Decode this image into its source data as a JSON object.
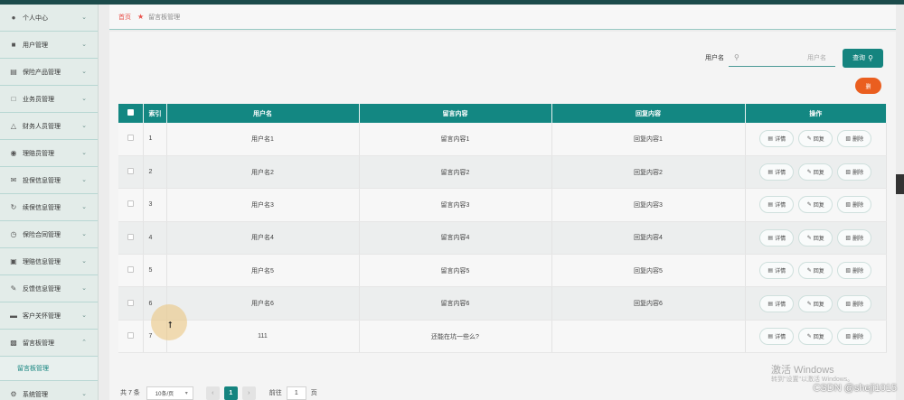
{
  "sidebar": {
    "items": [
      {
        "label": "个人中心",
        "icon": "user-icon"
      },
      {
        "label": "用户管理",
        "icon": "users-icon"
      },
      {
        "label": "保险产品管理",
        "icon": "product-icon"
      },
      {
        "label": "业务员管理",
        "icon": "briefcase-icon"
      },
      {
        "label": "财务人员管理",
        "icon": "finance-icon"
      },
      {
        "label": "理赔员管理",
        "icon": "location-icon"
      },
      {
        "label": "投保信息管理",
        "icon": "mail-icon"
      },
      {
        "label": "续保信息管理",
        "icon": "renew-icon"
      },
      {
        "label": "保险合同管理",
        "icon": "clock-icon"
      },
      {
        "label": "理赔信息管理",
        "icon": "document-icon"
      },
      {
        "label": "反馈信息管理",
        "icon": "feedback-icon"
      },
      {
        "label": "客户关怀管理",
        "icon": "folder-icon"
      },
      {
        "label": "留言板管理",
        "icon": "message-icon"
      }
    ],
    "submenu_label": "留言板管理",
    "last_item": {
      "label": "系统管理",
      "icon": "gear-icon"
    }
  },
  "breadcrumb": {
    "home": "首页",
    "current": "留言板管理"
  },
  "search": {
    "label": "用户名",
    "placeholder": "用户名",
    "button": "查询"
  },
  "delete_all_label": "删",
  "table": {
    "headers": {
      "index": "索引",
      "username": "用户名",
      "message": "留言内容",
      "reply": "回复内容",
      "actions": "操作"
    },
    "rows": [
      {
        "index": "1",
        "username": "用户名1",
        "message": "留言内容1",
        "reply": "回复内容1"
      },
      {
        "index": "2",
        "username": "用户名2",
        "message": "留言内容2",
        "reply": "回复内容2"
      },
      {
        "index": "3",
        "username": "用户名3",
        "message": "留言内容3",
        "reply": "回复内容3"
      },
      {
        "index": "4",
        "username": "用户名4",
        "message": "留言内容4",
        "reply": "回复内容4"
      },
      {
        "index": "5",
        "username": "用户名5",
        "message": "留言内容5",
        "reply": "回复内容5"
      },
      {
        "index": "6",
        "username": "用户名6",
        "message": "留言内容6",
        "reply": "回复内容6"
      },
      {
        "index": "7",
        "username": "111",
        "message": "还能在坑一些么?",
        "reply": ""
      }
    ],
    "actions": {
      "detail": "详情",
      "reply": "回复",
      "delete": "删除"
    }
  },
  "pagination": {
    "total": "共 7 条",
    "page_size": "10条/页",
    "current_page": "1",
    "goto_label": "前往",
    "goto_value": "1",
    "page_suffix": "页"
  },
  "watermark": {
    "title": "激活 Windows",
    "subtitle": "转到\"设置\"以激活 Windows。"
  },
  "csdn": "CSDN @sheji1015",
  "colors": {
    "accent": "#15847f",
    "orange": "#ea5e1f",
    "breadcrumb": "#e8504a"
  }
}
